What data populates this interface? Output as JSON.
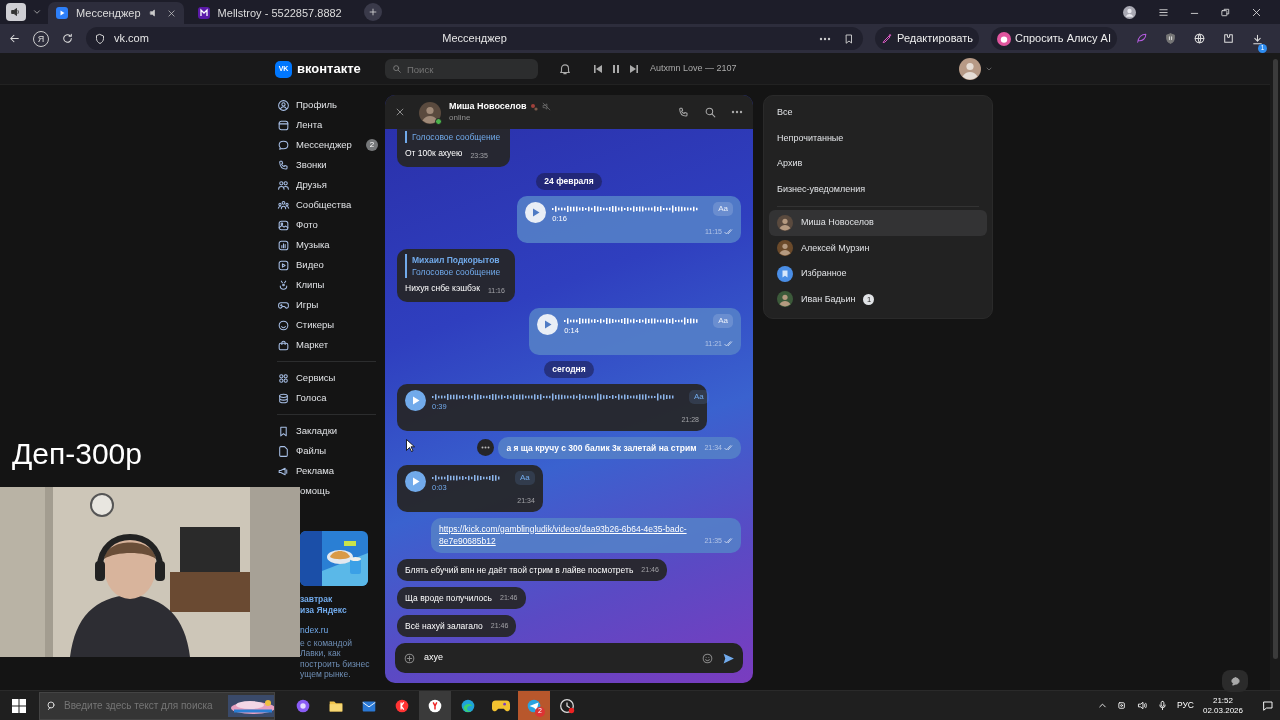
{
  "browser": {
    "tabs": [
      {
        "title": "Мессенджер",
        "selected": true,
        "audio": true
      },
      {
        "title": "Mellstroy - 5522857.8882",
        "selected": false,
        "audio": false
      }
    ],
    "home_mark": "Я",
    "address": "vk.com",
    "page_title": "Мессенджер",
    "actions": [
      {
        "label": "Редактировать",
        "kind": "edit"
      },
      {
        "label": "Спросить Алису AI",
        "kind": "alice"
      }
    ],
    "downloads_badge": "1"
  },
  "vk": {
    "logo_mark": "VK",
    "logo_text": "вконтакте",
    "search_placeholder": "Поиск",
    "track": "Autxmn Love — 2107"
  },
  "nav_groups": [
    {
      "items": [
        {
          "label": "Профиль"
        },
        {
          "label": "Лента"
        },
        {
          "label": "Мессенджер",
          "badge": "2"
        },
        {
          "label": "Звонки"
        },
        {
          "label": "Друзья"
        },
        {
          "label": "Сообщества"
        },
        {
          "label": "Фото"
        },
        {
          "label": "Музыка"
        },
        {
          "label": "Видео"
        },
        {
          "label": "Клипы"
        },
        {
          "label": "Игры"
        },
        {
          "label": "Стикеры"
        },
        {
          "label": "Маркет"
        }
      ]
    },
    {
      "items": [
        {
          "label": "Сервисы"
        },
        {
          "label": "Голоса"
        }
      ]
    },
    {
      "items": [
        {
          "label": "Закладки"
        },
        {
          "label": "Файлы"
        },
        {
          "label": "Реклама"
        },
        {
          "label": "омощь"
        }
      ]
    }
  ],
  "ad": {
    "lines": [
      {
        "text": "завтрак",
        "kind": "title"
      },
      {
        "text": "иза Яндекс",
        "kind": "title"
      },
      {
        "text": "ndex.ru",
        "kind": "domain"
      },
      {
        "text": "е с командой",
        "kind": "body"
      },
      {
        "text": "Лавки, как",
        "kind": "body"
      },
      {
        "text": "построить бизнес",
        "kind": "body"
      },
      {
        "text": "ущем рынке.",
        "kind": "body"
      }
    ]
  },
  "chat": {
    "name": "Миша Новоселов",
    "status": "online",
    "online": true,
    "muted": true,
    "messages": [
      {
        "kind": "reply",
        "outgoing": false,
        "quote": "Голосовое сообщение",
        "text": "От 100к ахуею",
        "time": "23:35"
      },
      {
        "kind": "date",
        "text": "24 февраля"
      },
      {
        "kind": "voice",
        "outgoing": true,
        "duration": "0:16",
        "transcribe": "Aa",
        "time": "11:15",
        "read": true
      },
      {
        "kind": "reply",
        "outgoing": false,
        "sender": "Михаил Подкорытов",
        "quote": "Голосовое сообщение",
        "text": "Нихуя снбе кэшбэк",
        "time": "11:16"
      },
      {
        "kind": "voice",
        "outgoing": true,
        "duration": "0:14",
        "transcribe": "Aa",
        "time": "11:21",
        "read": true
      },
      {
        "kind": "date",
        "text": "сегодня"
      },
      {
        "kind": "voice",
        "outgoing": false,
        "duration": "0:39",
        "transcribe": "Aa",
        "time": "21:28"
      },
      {
        "kind": "text",
        "outgoing": true,
        "text": "а я ща кручу с 300 балик 3к залетай на стрим",
        "time": "21:34",
        "read": true,
        "menu_shown": true
      },
      {
        "kind": "voice",
        "outgoing": false,
        "duration": "0:03",
        "transcribe": "Aa",
        "time": "21:34"
      },
      {
        "kind": "link",
        "outgoing": true,
        "text": "https://kick.com/gamblingludik/videos/daa93b26-6b64-4e35-badc-8e7e90685b12",
        "time": "21:35",
        "read": true
      },
      {
        "kind": "text",
        "outgoing": false,
        "text": "Блять ебучий впн не даёт твой стрим в лайве посмотреть",
        "time": "21:46"
      },
      {
        "kind": "text",
        "outgoing": false,
        "text": "Ща вроде получилось",
        "time": "21:46"
      },
      {
        "kind": "text",
        "outgoing": false,
        "text": "Всё нахуй залагало",
        "time": "21:46"
      }
    ],
    "composer": {
      "value": "ахуе"
    }
  },
  "folders": {
    "filters": [
      "Все",
      "Непрочитанные",
      "Архив",
      "Бизнес-уведомления"
    ],
    "chats": [
      {
        "name": "Миша Новоселов",
        "selected": true,
        "kind": "contact"
      },
      {
        "name": "Алексей Мурзин",
        "selected": false,
        "kind": "contact"
      },
      {
        "name": "Избранное",
        "selected": false,
        "kind": "saved"
      },
      {
        "name": "Иван Бадьин",
        "selected": false,
        "kind": "contact",
        "badge": "1"
      }
    ]
  },
  "overlay": {
    "caption": "Деп-300р"
  },
  "taskbar": {
    "search_placeholder": "Введите здесь текст для поиска",
    "apps": [
      {
        "kind": "assistant",
        "selected": false
      },
      {
        "kind": "folder",
        "selected": false
      },
      {
        "kind": "mail",
        "selected": false
      },
      {
        "kind": "yandex",
        "selected": false
      },
      {
        "kind": "browser",
        "selected": true
      },
      {
        "kind": "edge",
        "selected": false
      },
      {
        "kind": "game",
        "selected": false
      },
      {
        "kind": "messenger",
        "selected": true,
        "badge": "2"
      },
      {
        "kind": "clock",
        "selected": false
      }
    ],
    "lang": "РУС",
    "time": "21:52",
    "date": "02.03.2026"
  }
}
